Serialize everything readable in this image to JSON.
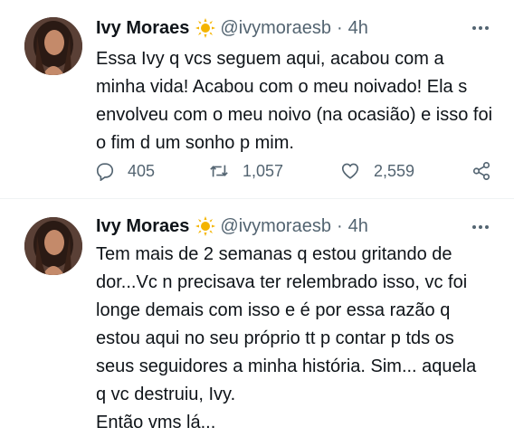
{
  "tweets": [
    {
      "author_name": "Ivy Moraes",
      "handle": "@ivymoraesb",
      "separator": "·",
      "time": "4h",
      "text_lines": [
        "Essa Ivy q vcs seguem aqui, acabou com a",
        "minha vida! Acabou com o meu noivado! Ela s",
        "envolveu com o meu noivo (na ocasião) e isso foi",
        "o fim d um sonho p mim."
      ],
      "replies": "405",
      "retweets": "1,057",
      "likes": "2,559"
    },
    {
      "author_name": "Ivy Moraes",
      "handle": "@ivymoraesb",
      "separator": "·",
      "time": "4h",
      "text_lines": [
        "Tem mais de 2 semanas q estou gritando de",
        "dor...Vc n precisava ter relembrado isso, vc foi",
        "longe demais com isso e é por essa razão q",
        "estou aqui no seu próprio tt p contar p tds os",
        "seus seguidores a minha história. Sim... aquela",
        "q vc destruiu, Ivy.",
        "Então vms lá..."
      ]
    }
  ],
  "icons": {
    "badge": "sun-emoji-icon",
    "more": "more-options-icon",
    "reply": "reply-icon",
    "retweet": "retweet-icon",
    "like": "heart-icon",
    "share": "share-icon"
  },
  "colors": {
    "text": "#0f1419",
    "secondary": "#536471",
    "sun": "#f4b400",
    "divider": "#eff3f4"
  }
}
